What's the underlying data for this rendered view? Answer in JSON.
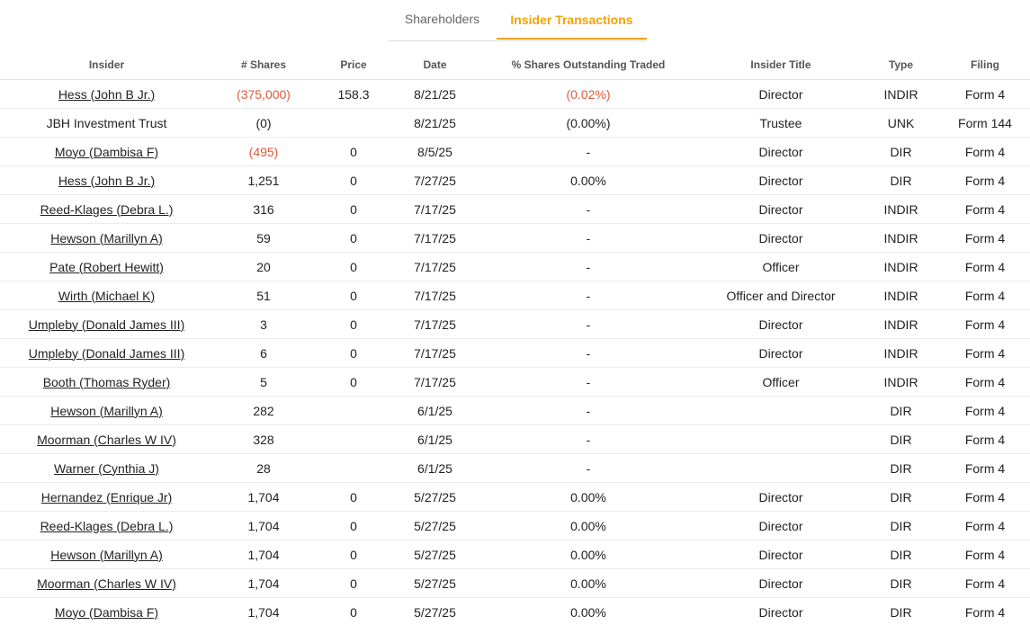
{
  "tabs": [
    {
      "label": "Shareholders",
      "active": false
    },
    {
      "label": "Insider Transactions",
      "active": true
    }
  ],
  "colors": {
    "accent": "#f0a30a",
    "negative": "#e05a3c",
    "text": "#222222"
  },
  "table": {
    "columns": [
      "Insider",
      "# Shares",
      "Price",
      "Date",
      "% Shares Outstanding Traded",
      "Insider Title",
      "Type",
      "Filing"
    ],
    "rows": [
      {
        "insider": "Hess (John B Jr.)",
        "linked": true,
        "shares": "(375,000)",
        "shares_negative": true,
        "price": "158.3",
        "date": "8/21/25",
        "pct": "(0.02%)",
        "pct_negative": true,
        "title": "Director",
        "type": "INDIR",
        "filing": "Form 4"
      },
      {
        "insider": "JBH Investment Trust",
        "linked": false,
        "shares": "(0)",
        "shares_negative": false,
        "price": "",
        "date": "8/21/25",
        "pct": "(0.00%)",
        "pct_negative": false,
        "title": "Trustee",
        "type": "UNK",
        "filing": "Form 144"
      },
      {
        "insider": "Moyo (Dambisa F)",
        "linked": true,
        "shares": "(495)",
        "shares_negative": true,
        "price": "0",
        "date": "8/5/25",
        "pct": "-",
        "pct_negative": false,
        "title": "Director",
        "type": "DIR",
        "filing": "Form 4"
      },
      {
        "insider": "Hess (John B Jr.)",
        "linked": true,
        "shares": "1,251",
        "shares_negative": false,
        "price": "0",
        "date": "7/27/25",
        "pct": "0.00%",
        "pct_negative": false,
        "title": "Director",
        "type": "DIR",
        "filing": "Form 4"
      },
      {
        "insider": "Reed-Klages (Debra L.)",
        "linked": true,
        "shares": "316",
        "shares_negative": false,
        "price": "0",
        "date": "7/17/25",
        "pct": "-",
        "pct_negative": false,
        "title": "Director",
        "type": "INDIR",
        "filing": "Form 4"
      },
      {
        "insider": "Hewson (Marillyn A)",
        "linked": true,
        "shares": "59",
        "shares_negative": false,
        "price": "0",
        "date": "7/17/25",
        "pct": "-",
        "pct_negative": false,
        "title": "Director",
        "type": "INDIR",
        "filing": "Form 4"
      },
      {
        "insider": "Pate (Robert Hewitt)",
        "linked": true,
        "shares": "20",
        "shares_negative": false,
        "price": "0",
        "date": "7/17/25",
        "pct": "-",
        "pct_negative": false,
        "title": "Officer",
        "type": "INDIR",
        "filing": "Form 4"
      },
      {
        "insider": "Wirth (Michael K)",
        "linked": true,
        "shares": "51",
        "shares_negative": false,
        "price": "0",
        "date": "7/17/25",
        "pct": "-",
        "pct_negative": false,
        "title": "Officer and Director",
        "type": "INDIR",
        "filing": "Form 4"
      },
      {
        "insider": "Umpleby (Donald James III)",
        "linked": true,
        "shares": "3",
        "shares_negative": false,
        "price": "0",
        "date": "7/17/25",
        "pct": "-",
        "pct_negative": false,
        "title": "Director",
        "type": "INDIR",
        "filing": "Form 4"
      },
      {
        "insider": "Umpleby (Donald James III)",
        "linked": true,
        "shares": "6",
        "shares_negative": false,
        "price": "0",
        "date": "7/17/25",
        "pct": "-",
        "pct_negative": false,
        "title": "Director",
        "type": "INDIR",
        "filing": "Form 4"
      },
      {
        "insider": "Booth (Thomas Ryder)",
        "linked": true,
        "shares": "5",
        "shares_negative": false,
        "price": "0",
        "date": "7/17/25",
        "pct": "-",
        "pct_negative": false,
        "title": "Officer",
        "type": "INDIR",
        "filing": "Form 4"
      },
      {
        "insider": "Hewson (Marillyn A)",
        "linked": true,
        "shares": "282",
        "shares_negative": false,
        "price": "",
        "date": "6/1/25",
        "pct": "-",
        "pct_negative": false,
        "title": "",
        "type": "DIR",
        "filing": "Form 4"
      },
      {
        "insider": "Moorman (Charles W IV)",
        "linked": true,
        "shares": "328",
        "shares_negative": false,
        "price": "",
        "date": "6/1/25",
        "pct": "-",
        "pct_negative": false,
        "title": "",
        "type": "DIR",
        "filing": "Form 4"
      },
      {
        "insider": "Warner (Cynthia J)",
        "linked": true,
        "shares": "28",
        "shares_negative": false,
        "price": "",
        "date": "6/1/25",
        "pct": "-",
        "pct_negative": false,
        "title": "",
        "type": "DIR",
        "filing": "Form 4"
      },
      {
        "insider": "Hernandez (Enrique Jr)",
        "linked": true,
        "shares": "1,704",
        "shares_negative": false,
        "price": "0",
        "date": "5/27/25",
        "pct": "0.00%",
        "pct_negative": false,
        "title": "Director",
        "type": "DIR",
        "filing": "Form 4"
      },
      {
        "insider": "Reed-Klages (Debra L.)",
        "linked": true,
        "shares": "1,704",
        "shares_negative": false,
        "price": "0",
        "date": "5/27/25",
        "pct": "0.00%",
        "pct_negative": false,
        "title": "Director",
        "type": "DIR",
        "filing": "Form 4"
      },
      {
        "insider": "Hewson (Marillyn A)",
        "linked": true,
        "shares": "1,704",
        "shares_negative": false,
        "price": "0",
        "date": "5/27/25",
        "pct": "0.00%",
        "pct_negative": false,
        "title": "Director",
        "type": "DIR",
        "filing": "Form 4"
      },
      {
        "insider": "Moorman (Charles W IV)",
        "linked": true,
        "shares": "1,704",
        "shares_negative": false,
        "price": "0",
        "date": "5/27/25",
        "pct": "0.00%",
        "pct_negative": false,
        "title": "Director",
        "type": "DIR",
        "filing": "Form 4"
      },
      {
        "insider": "Moyo (Dambisa F)",
        "linked": true,
        "shares": "1,704",
        "shares_negative": false,
        "price": "0",
        "date": "5/27/25",
        "pct": "0.00%",
        "pct_negative": false,
        "title": "Director",
        "type": "DIR",
        "filing": "Form 4"
      }
    ]
  }
}
